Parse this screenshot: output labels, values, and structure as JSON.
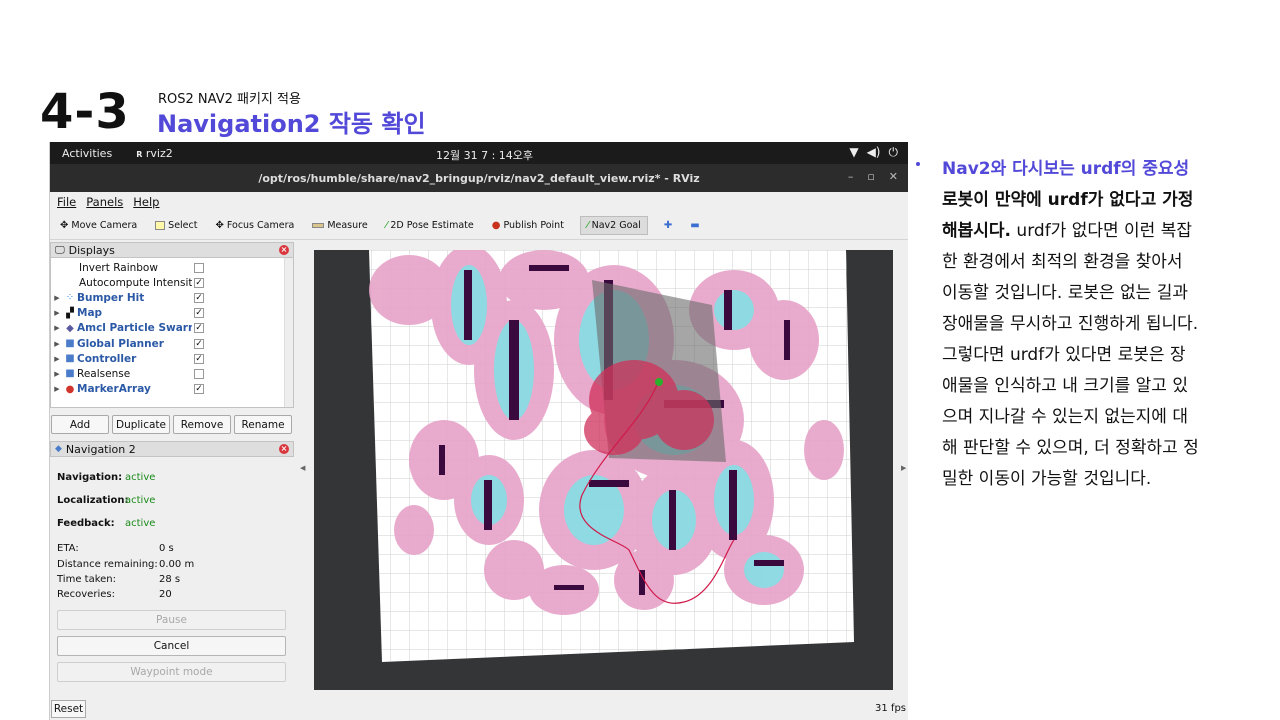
{
  "slide": {
    "number": "4-3",
    "subtitle": "ROS2 NAV2 패키지 적용",
    "title": "Navigation2 작동 확인"
  },
  "desktop": {
    "activities": "Activities",
    "app_name": "rviz2",
    "clock": "12월 31  7 : 14오후"
  },
  "window": {
    "title": "/opt/ros/humble/share/nav2_bringup/rviz/nav2_default_view.rviz* - RViz"
  },
  "menu": [
    "File",
    "Panels",
    "Help"
  ],
  "toolbar": {
    "move_camera": "Move Camera",
    "select": "Select",
    "focus_camera": "Focus Camera",
    "measure": "Measure",
    "pose_estimate": "2D Pose Estimate",
    "publish_point": "Publish Point",
    "nav2_goal": "Nav2 Goal"
  },
  "displays": {
    "title": "Displays",
    "rows": [
      {
        "label": "Invert Rainbow",
        "checked": ""
      },
      {
        "label": "Autocompute Intensit...",
        "checked": "✓"
      },
      {
        "label": "Bumper Hit",
        "checked": "✓"
      },
      {
        "label": "Map",
        "checked": "✓"
      },
      {
        "label": "Amcl Particle Swarm",
        "checked": "✓"
      },
      {
        "label": "Global Planner",
        "checked": "✓"
      },
      {
        "label": "Controller",
        "checked": "✓"
      },
      {
        "label": "Realsense",
        "checked": ""
      },
      {
        "label": "MarkerArray",
        "checked": "✓"
      }
    ],
    "buttons": {
      "add": "Add",
      "duplicate": "Duplicate",
      "remove": "Remove",
      "rename": "Rename"
    }
  },
  "navigation_panel": {
    "title": "Navigation 2",
    "navigation_label": "Navigation:",
    "navigation_value": "active",
    "localization_label": "Localization:",
    "localization_value": "active",
    "feedback_label": "Feedback:",
    "feedback_value": "active",
    "eta_label": "ETA:",
    "eta_value": "0 s",
    "distance_label": "Distance remaining:",
    "distance_value": "0.00 m",
    "time_label": "Time taken:",
    "time_value": "28 s",
    "recoveries_label": "Recoveries:",
    "recoveries_value": "20",
    "pause": "Pause",
    "cancel": "Cancel",
    "waypoint": "Waypoint mode"
  },
  "footer": {
    "reset": "Reset",
    "fps": "31 fps"
  },
  "notes": {
    "heading": "Nav2와 다시보는 urdf의 중요성",
    "lines": [
      "로봇이 만약에 urdf가 없다고 가정",
      "해봅시다.",
      "한 환경에서 최적의 환경을 찾아서",
      "이동할 것입니다. 로봇은 없는 길과",
      "장애물을 무시하고 진행하게 됩니다.",
      "그렇다면 urdf가 있다면 로봇은 장",
      "애물을 인식하고 내 크기를 알고 있",
      "으며 지나갈 수 있는지 없는지에 대",
      "해 판단할 수 있으며, 더 정확하고 정",
      "밀한 이동이 가능할 것입니다."
    ],
    "line2_tail": " urdf가 없다면 이런 복잡"
  },
  "colors": {
    "accent": "#5249d8",
    "active_green": "#1a8a1a"
  }
}
